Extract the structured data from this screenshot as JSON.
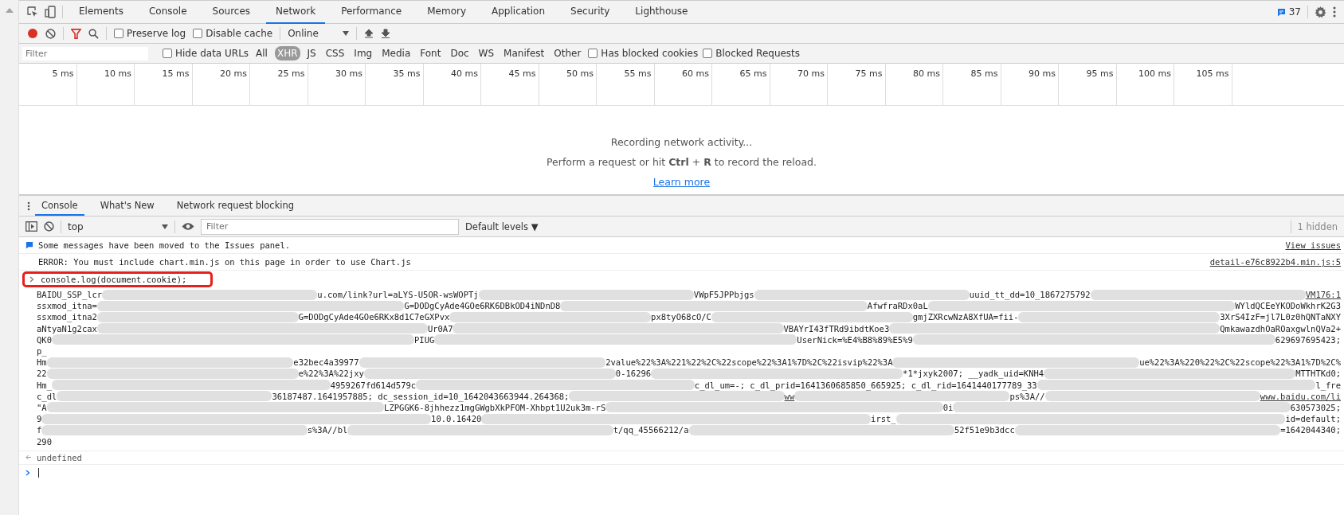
{
  "main_tabs": [
    {
      "label": "Elements",
      "selected": false
    },
    {
      "label": "Console",
      "selected": false
    },
    {
      "label": "Sources",
      "selected": false
    },
    {
      "label": "Network",
      "selected": true
    },
    {
      "label": "Performance",
      "selected": false
    },
    {
      "label": "Memory",
      "selected": false
    },
    {
      "label": "Application",
      "selected": false
    },
    {
      "label": "Security",
      "selected": false
    },
    {
      "label": "Lighthouse",
      "selected": false
    }
  ],
  "issues_count": "37",
  "network_toolbar": {
    "recording": true,
    "filter_active": true,
    "preserve_log": {
      "label": "Preserve log",
      "checked": false
    },
    "disable_cache": {
      "label": "Disable cache",
      "checked": false
    },
    "throttling": "Online"
  },
  "filter_bar": {
    "placeholder": "Filter",
    "hide_data_urls": {
      "label": "Hide data URLs",
      "checked": false
    },
    "types": [
      {
        "label": "All",
        "selected": false
      },
      {
        "label": "XHR",
        "selected": true
      },
      {
        "label": "JS",
        "selected": false
      },
      {
        "label": "CSS",
        "selected": false
      },
      {
        "label": "Img",
        "selected": false
      },
      {
        "label": "Media",
        "selected": false
      },
      {
        "label": "Font",
        "selected": false
      },
      {
        "label": "Doc",
        "selected": false
      },
      {
        "label": "WS",
        "selected": false
      },
      {
        "label": "Manifest",
        "selected": false
      },
      {
        "label": "Other",
        "selected": false
      }
    ],
    "has_blocked_cookies": {
      "label": "Has blocked cookies",
      "checked": false
    },
    "blocked_requests": {
      "label": "Blocked Requests",
      "checked": false
    }
  },
  "timeline_ticks": [
    "5 ms",
    "10 ms",
    "15 ms",
    "20 ms",
    "25 ms",
    "30 ms",
    "35 ms",
    "40 ms",
    "45 ms",
    "50 ms",
    "55 ms",
    "60 ms",
    "65 ms",
    "70 ms",
    "75 ms",
    "80 ms",
    "85 ms",
    "90 ms",
    "95 ms",
    "100 ms",
    "105 ms"
  ],
  "empty_state": {
    "title": "Recording network activity...",
    "hint": "Perform a request or hit **Ctrl** + **R** to record the reload.",
    "link": "Learn more"
  },
  "drawer_tabs": [
    {
      "label": "Console",
      "selected": true
    },
    {
      "label": "What's New",
      "selected": false
    },
    {
      "label": "Network request blocking",
      "selected": false
    }
  ],
  "console_toolbar": {
    "context": "top",
    "filter_placeholder": "Filter",
    "levels": "Default levels ▼",
    "hidden": "1 hidden"
  },
  "messages": [
    {
      "kind": "info",
      "text": "Some messages have been moved to the Issues panel.",
      "source": "View issues"
    },
    {
      "kind": "log",
      "text": "ERROR: You must include chart.min.js on this page in order to use Chart.js",
      "source": "detail-e76c8922b4.min.js:5"
    }
  ],
  "command": {
    "text": "console.log(document.cookie);",
    "highlighted": true
  },
  "output_source": "VM176:1",
  "output_lines": [
    [
      {
        "kind": "text",
        "text": "BAIDU_SSP_lcr"
      },
      {
        "kind": "text",
        "text": "u.com/link?url=aLYS-U5OR-wsWOPTj"
      },
      {
        "kind": "text",
        "text": "VWpF5JPPbjgs"
      },
      {
        "kind": "text",
        "text": "uuid_tt_dd=10_1867275792"
      }
    ],
    [
      {
        "kind": "text",
        "text": "ssxmod_itna="
      },
      {
        "kind": "text",
        "text": "G=DODgCyAde4GOe6RK6DBkOD4iNDnD8"
      },
      {
        "kind": "text",
        "text": "AfwfraRDx0aL"
      },
      {
        "kind": "text",
        "text": "WYldQCEeYKODoWkhrK2G3"
      }
    ],
    [
      {
        "kind": "text",
        "text": "ssxmod_itna2"
      },
      {
        "kind": "text",
        "text": "G=DODgCyAde4GOe6RKx8d1C7eGXPvx"
      },
      {
        "kind": "text",
        "text": "px8tyO68cO/C"
      },
      {
        "kind": "text",
        "text": "gmjZXRcwNzA8XfUA=fii-"
      },
      {
        "kind": "text",
        "text": "3XrS4IzF=jl7L0z0hQNTaNXY"
      }
    ],
    [
      {
        "kind": "text",
        "text": "aNtyaN1g2cax"
      },
      {
        "kind": "text",
        "text": "Ur0A7"
      },
      {
        "kind": "text",
        "text": "VBAYrI43fTRd9ibdtKoe3"
      },
      {
        "kind": "text",
        "text": "QmkawazdhOaROaxgwlnQVa2+"
      }
    ],
    [
      {
        "kind": "text",
        "text": "QK0"
      },
      {
        "kind": "text",
        "text": "PIUG"
      },
      {
        "kind": "text",
        "text": "UserNick=%E4%B8%89%E5%9"
      },
      {
        "kind": "text",
        "text": "629697695423;"
      }
    ],
    [
      {
        "kind": "text",
        "text": "p_"
      }
    ],
    [
      {
        "kind": "text",
        "text": "Hm"
      },
      {
        "kind": "text",
        "text": "e32bec4a39977"
      },
      {
        "kind": "text",
        "text": "2value%22%3A%221%22%2C%22scope%22%3A1%7D%2C%22isvip%22%3A"
      },
      {
        "kind": "text",
        "text": "ue%22%3A%220%22%2C%22scope%22%3A1%7D%2C%"
      }
    ],
    [
      {
        "kind": "text",
        "text": "22"
      },
      {
        "kind": "text",
        "text": "e%22%3A%22jxy"
      },
      {
        "kind": "text",
        "text": "0-16296"
      },
      {
        "kind": "text",
        "text": "*1*jxyk2007; __yadk_uid=KNH4"
      },
      {
        "kind": "text",
        "text": "MTTHTKd0;"
      }
    ],
    [
      {
        "kind": "text",
        "text": "Hm_"
      },
      {
        "kind": "text",
        "text": "4959267fd614d579c"
      },
      {
        "kind": "text",
        "text": "c_dl_um=-; c_dl_prid=1641360685850_665925; c_dl_rid=1641440177789_33"
      },
      {
        "kind": "text",
        "text": "l_fre"
      }
    ],
    [
      {
        "kind": "text",
        "text": "c_dl"
      },
      {
        "kind": "text",
        "text": "36187487.1641957885; dc_session_id=10_1642043663944.264368;"
      },
      {
        "kind": "link",
        "text": "ww"
      },
      {
        "kind": "text",
        "text": "ps%3A//"
      },
      {
        "kind": "link",
        "text": "www.baidu.com/li"
      }
    ],
    [
      {
        "kind": "text",
        "text": "\"A"
      },
      {
        "kind": "text",
        "text": "LZPGGK6-8jhhezz1mgGWgbXkPFOM-Xhbpt1U2uk3m-rS"
      },
      {
        "kind": "text",
        "text": "0i"
      },
      {
        "kind": "text",
        "text": "630573025;"
      }
    ],
    [
      {
        "kind": "text",
        "text": "9"
      },
      {
        "kind": "text",
        "text": "10.0.16420"
      },
      {
        "kind": "text",
        "text": "irst_"
      },
      {
        "kind": "text",
        "text": "id=default;"
      }
    ],
    [
      {
        "kind": "text",
        "text": "f"
      },
      {
        "kind": "text",
        "text": "s%3A//bl"
      },
      {
        "kind": "text",
        "text": "t/qq_45566212/a"
      },
      {
        "kind": "text",
        "text": "52f51e9b3dcc"
      },
      {
        "kind": "text",
        "text": "=1642044340;"
      }
    ],
    [
      {
        "kind": "text",
        "text": "290"
      }
    ]
  ],
  "result": "undefined"
}
